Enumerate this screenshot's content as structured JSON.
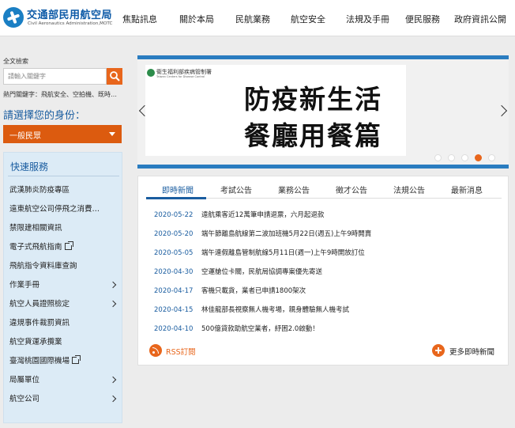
{
  "header": {
    "title": "交通部民用航空局",
    "subtitle": "Civil Aeronautics Administration,MOTC",
    "nav": [
      "焦點訊息",
      "關於本局",
      "民航業務",
      "航空安全",
      "法規及手冊",
      "便民服務",
      "政府資訊公開"
    ]
  },
  "search": {
    "title": "全文檢索",
    "placeholder": "請輸入關鍵字",
    "hot_keywords": "熱門關鍵字：飛航安全、空拍機、既時…"
  },
  "identity": {
    "title": "請選擇您的身份：",
    "selected": "一般民眾"
  },
  "quick": {
    "title": "快速服務",
    "items": [
      {
        "label": "武漢肺炎防疫專區"
      },
      {
        "label": "遠東航空公司停飛之消費…"
      },
      {
        "label": "禁限建相關資訊"
      },
      {
        "label": "電子式飛航指南"
      },
      {
        "label": "飛航指令資料庫查詢"
      },
      {
        "label": "作業手冊"
      },
      {
        "label": "航空人員證照檢定"
      },
      {
        "label": "違規事件裁罰資訊"
      },
      {
        "label": "航空貨運承攬業"
      },
      {
        "label": "臺灣桃園國際機場"
      },
      {
        "label": "局屬單位"
      },
      {
        "label": "航空公司"
      }
    ]
  },
  "banner": {
    "org": "衛生福利部疾病管制署",
    "org_sub": "Taiwan Centers for Disease Control",
    "line1": "防疫新生活",
    "line2": "餐廳用餐篇"
  },
  "news": {
    "tabs": [
      "即時新聞",
      "考試公告",
      "業務公告",
      "徵才公告",
      "法規公告",
      "最新消息"
    ],
    "rows": [
      {
        "date": "2020-05-22",
        "title": "遠航乘客近12萬筆申請退票，六月起退款"
      },
      {
        "date": "2020-05-20",
        "title": "端午節離島航線第二波加班機5月22日(週五)上午9時開賣"
      },
      {
        "date": "2020-05-05",
        "title": "端午連假離島管制航線5月11日(週一)上午9時開放訂位"
      },
      {
        "date": "2020-04-30",
        "title": "空運艙位卡關，民航局協調專案優先寄送"
      },
      {
        "date": "2020-04-17",
        "title": "客機只載貨，業者已申請1800架次"
      },
      {
        "date": "2020-04-15",
        "title": "林佳龍部長視察無人機考場，親身體驗無人機考試"
      },
      {
        "date": "2020-04-10",
        "title": "500億貸款助航空業者，紓困2.0啟動！"
      }
    ],
    "rss_label": "RSS訂閱",
    "more_label": "更多即時新聞"
  }
}
